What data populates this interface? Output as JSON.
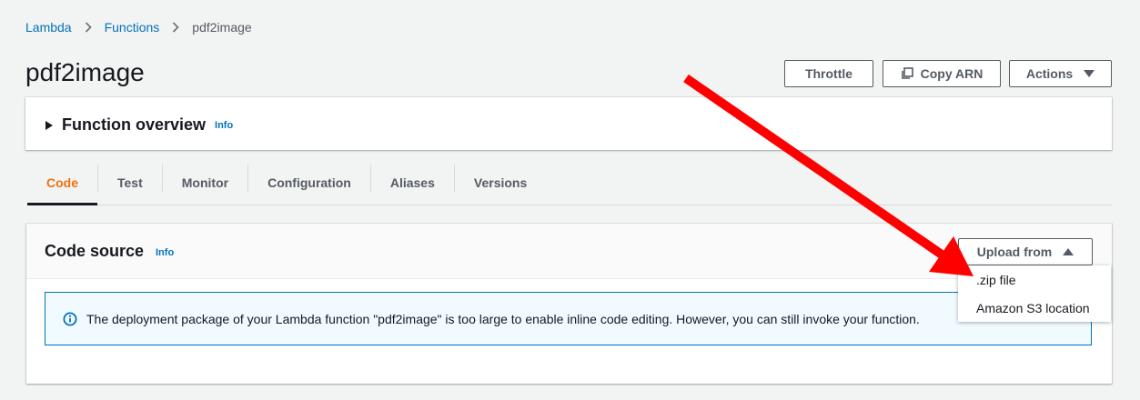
{
  "breadcrumb": {
    "items": [
      "Lambda",
      "Functions"
    ],
    "current": "pdf2image"
  },
  "page": {
    "title": "pdf2image"
  },
  "header_buttons": {
    "throttle": "Throttle",
    "copy_arn": "Copy ARN",
    "actions": "Actions"
  },
  "overview": {
    "title": "Function overview",
    "info": "Info"
  },
  "tabs": [
    {
      "label": "Code",
      "active": true
    },
    {
      "label": "Test",
      "active": false
    },
    {
      "label": "Monitor",
      "active": false
    },
    {
      "label": "Configuration",
      "active": false
    },
    {
      "label": "Aliases",
      "active": false
    },
    {
      "label": "Versions",
      "active": false
    }
  ],
  "code_source": {
    "title": "Code source",
    "info": "Info",
    "upload_label": "Upload from",
    "upload_options": [
      ".zip file",
      "Amazon S3 location"
    ],
    "alert_text": "The deployment package of your Lambda function \"pdf2image\" is too large to enable inline code editing. However, you can still invoke your function."
  },
  "icons": {
    "breadcrumb_separator": "chevron-right-icon",
    "copy": "copy-icon",
    "actions_caret": "caret-down-icon",
    "overview_toggle": "caret-right-icon",
    "upload_caret": "caret-up-icon",
    "alert": "info-circle-icon",
    "annotation": "red-arrow-annotation"
  },
  "colors": {
    "link": "#0073bb",
    "active_tab": "#ec7211",
    "background": "#f2f3f3",
    "annotation_arrow": "#ff0000",
    "alert_border": "#0073bb",
    "alert_background": "#f1faff"
  }
}
